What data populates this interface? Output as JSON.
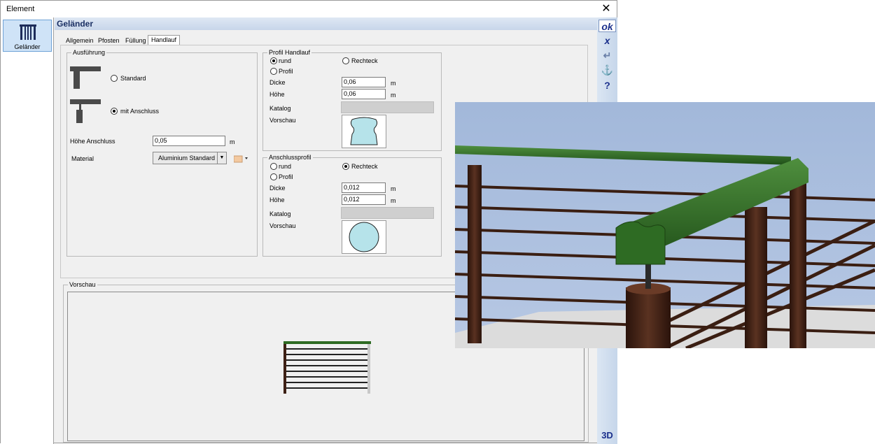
{
  "window": {
    "title": "Element",
    "close_symbol": "✕"
  },
  "left_panel": {
    "items": [
      {
        "label": "Geländer",
        "icon": "railing-icon"
      }
    ]
  },
  "header": {
    "title": "Geländer"
  },
  "tabs": [
    {
      "label": "Allgemein",
      "active": false
    },
    {
      "label": "Pfosten",
      "active": false
    },
    {
      "label": "Füllung",
      "active": false
    },
    {
      "label": "Handlauf",
      "active": true
    }
  ],
  "ausfuehrung": {
    "label": "Ausführung",
    "options": [
      {
        "label": "Standard",
        "selected": false
      },
      {
        "label": "mit Anschluss",
        "selected": true
      }
    ],
    "hoehe_label": "Höhe Anschluss",
    "hoehe_value": "0,05",
    "hoehe_unit": "m",
    "material_label": "Material",
    "material_value": "Aluminium Standard"
  },
  "profil_handlauf": {
    "label": "Profil Handlauf",
    "radio_rund": "rund",
    "radio_rechteck": "Rechteck",
    "radio_profil": "Profil",
    "selected": "rund",
    "dicke_label": "Dicke",
    "dicke_value": "0,06",
    "hoehe_label": "Höhe",
    "hoehe_value": "0,06",
    "unit": "m",
    "katalog_label": "Katalog",
    "vorschau_label": "Vorschau"
  },
  "anschlussprofil": {
    "label": "Anschlussprofil",
    "radio_rund": "rund",
    "radio_rechteck": "Rechteck",
    "radio_profil": "Profil",
    "selected": "Rechteck",
    "dicke_label": "Dicke",
    "dicke_value": "0,012",
    "hoehe_label": "Höhe",
    "hoehe_value": "0,012",
    "unit": "m",
    "katalog_label": "Katalog",
    "vorschau_label": "Vorschau"
  },
  "vorschau": {
    "label": "Vorschau"
  },
  "right_toolbar": {
    "ok": "ok",
    "cancel": "x",
    "threed": "3D",
    "help": "?"
  },
  "colors": {
    "accent": "#1a2f8c",
    "rail_green": "#2e6b23",
    "post_brown": "#3d2014",
    "sky": "#a9bfdf"
  }
}
